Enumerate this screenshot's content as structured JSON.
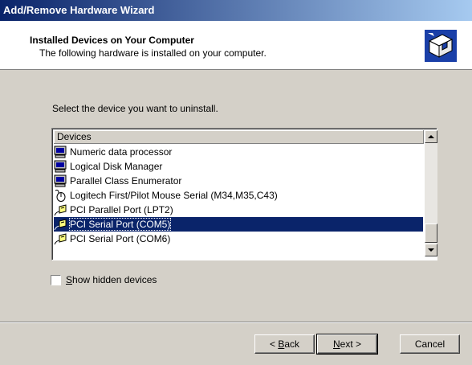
{
  "window": {
    "title": "Add/Remove Hardware Wizard"
  },
  "header": {
    "title": "Installed Devices on Your Computer",
    "subtitle": "The following hardware is installed on your computer.",
    "icon": "hardware-wizard-icon"
  },
  "prompt": "Select the device you want to uninstall.",
  "device_list": {
    "column_header": "Devices",
    "items": [
      {
        "label": "Numeric data processor",
        "icon": "computer-icon",
        "selected": false
      },
      {
        "label": "Logical Disk Manager",
        "icon": "computer-icon",
        "selected": false
      },
      {
        "label": "Parallel Class Enumerator",
        "icon": "computer-icon",
        "selected": false
      },
      {
        "label": "Logitech First/Pilot Mouse Serial (M34,M35,C43)",
        "icon": "mouse-icon",
        "selected": false
      },
      {
        "label": "PCI Parallel Port (LPT2)",
        "icon": "port-icon",
        "selected": false
      },
      {
        "label": "PCI Serial Port (COM5)",
        "icon": "port-icon",
        "selected": true
      },
      {
        "label": "PCI Serial Port (COM6)",
        "icon": "port-icon",
        "selected": false
      }
    ]
  },
  "show_hidden": {
    "label_accel": "S",
    "label_rest": "how hidden devices",
    "checked": false
  },
  "buttons": {
    "back_prefix": "< ",
    "back_accel": "B",
    "back_rest": "ack",
    "next_accel": "N",
    "next_rest": "ext >",
    "cancel": "Cancel"
  },
  "colors": {
    "selection": "#0a246a",
    "face": "#d4d0c8"
  }
}
